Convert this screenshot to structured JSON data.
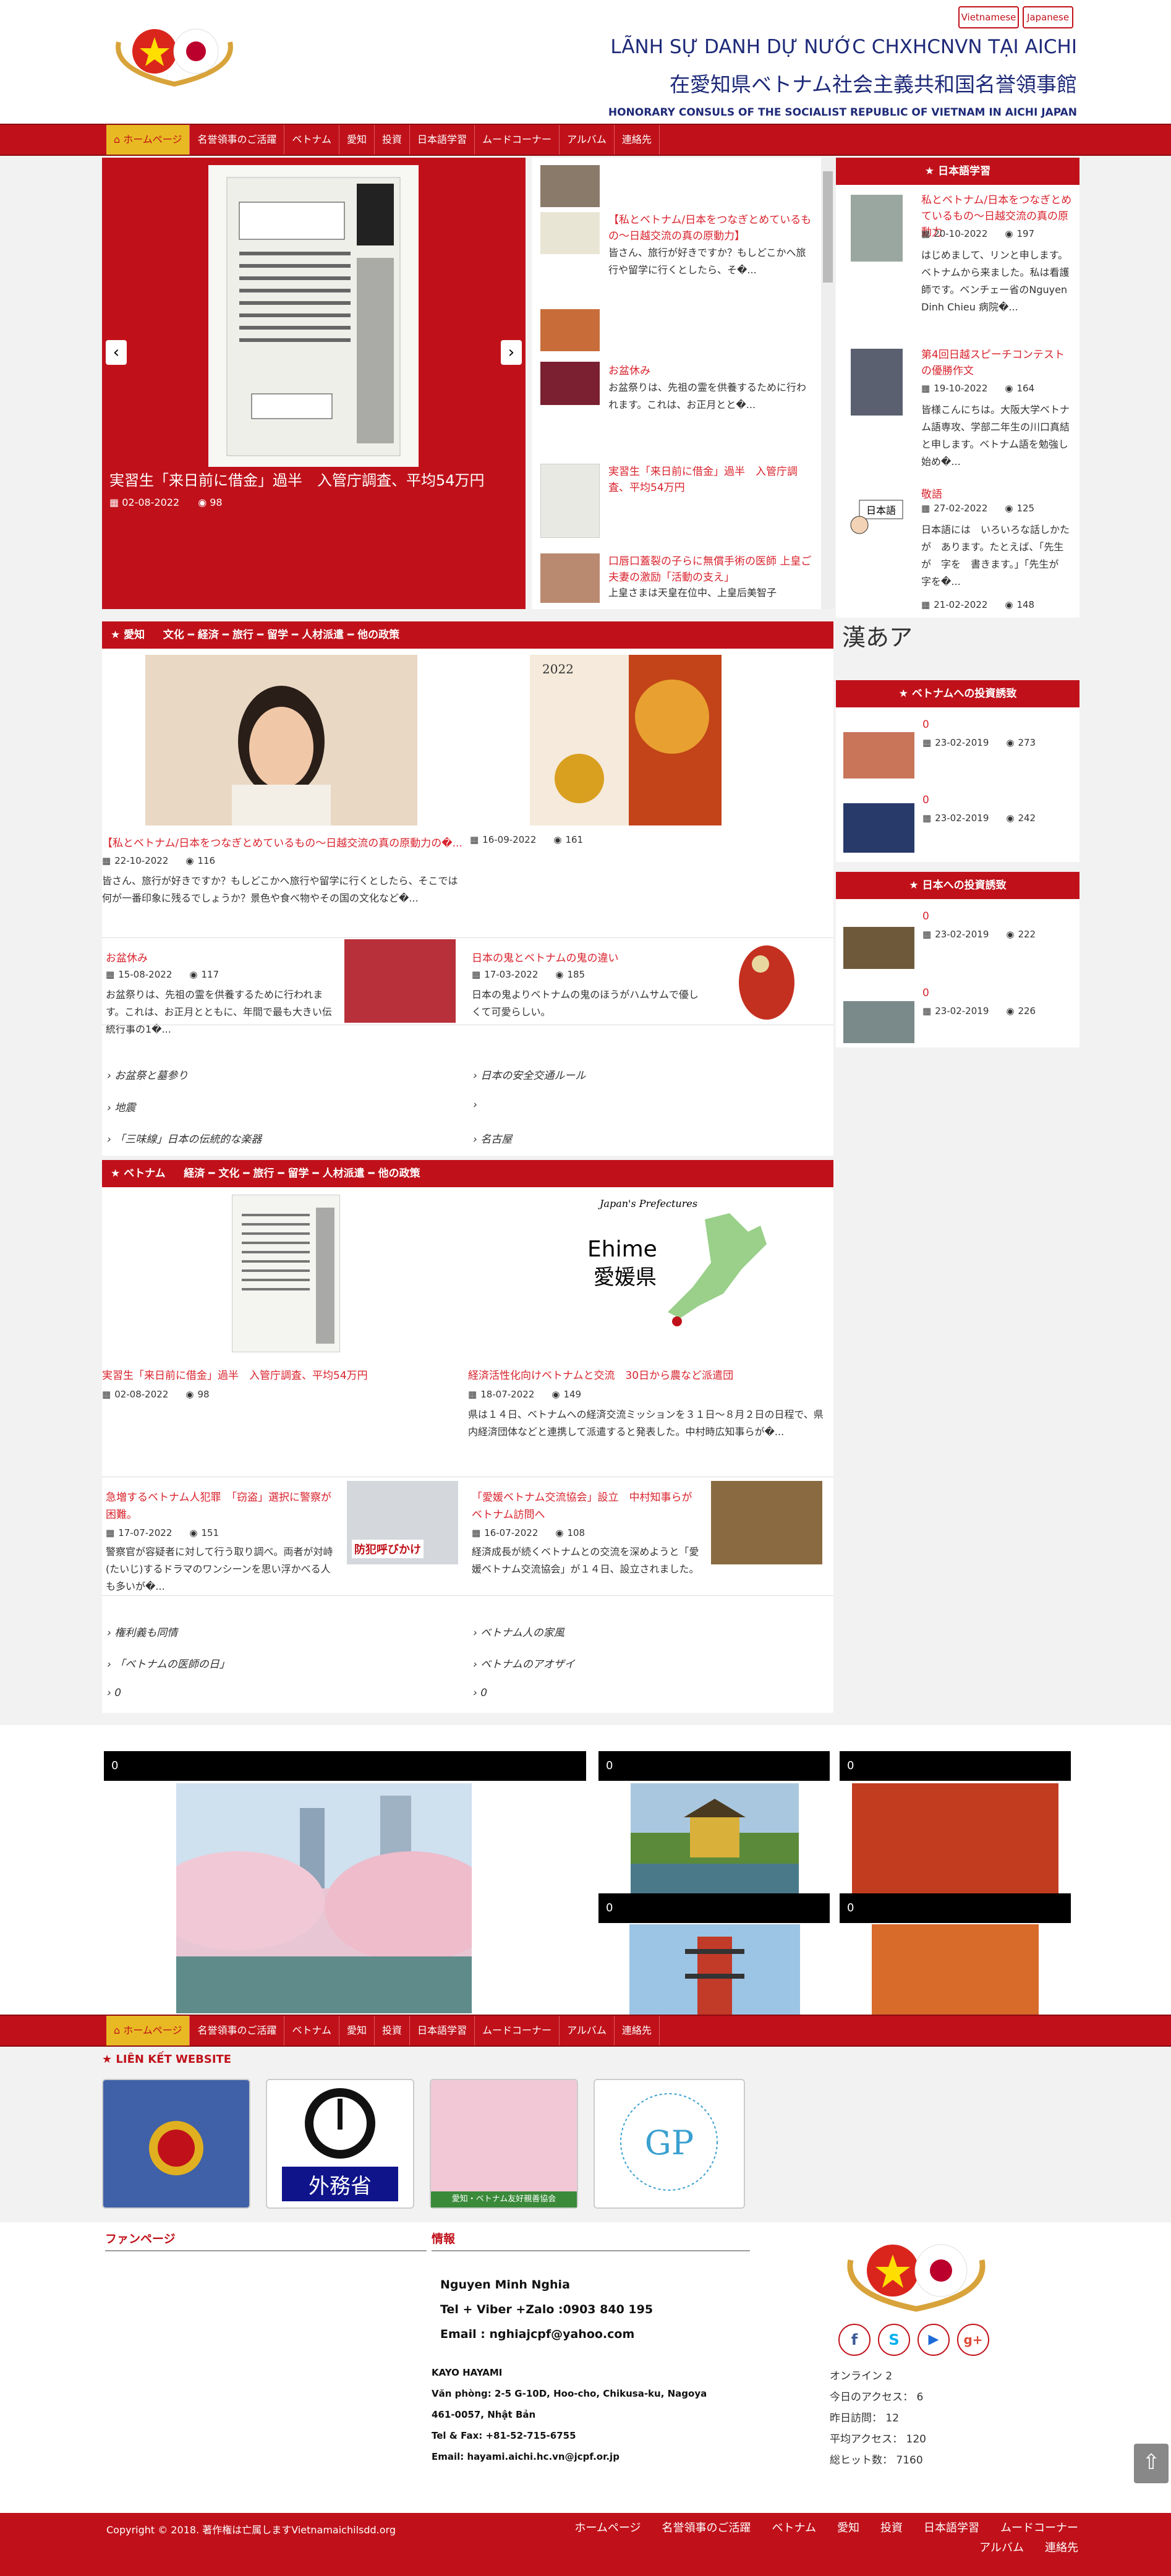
{
  "lang": {
    "vi": "Vietnamese",
    "ja": "Japanese"
  },
  "header": {
    "title_vi": "LÃNH SỰ DANH DỰ NƯỚC CHXHCNVN TẠI AICHI",
    "title_ja": "在愛知県ベトナム社会主義共和国名誉領事館",
    "title_en": "HONORARY CONSULS OF THE SOCIALIST REPUBLIC OF VIETNAM IN AICHI JAPAN"
  },
  "nav": [
    "ホームページ",
    "名誉領事のご活躍",
    "ベトナム",
    "愛知",
    "投資",
    "日本語学習",
    "ムードコーナー",
    "アルバム",
    "連絡先"
  ],
  "slider": {
    "caption": "実習生「来日前に借金」過半　入管庁調査、平均54万円",
    "date": "02-08-2022",
    "views": "98"
  },
  "news_list": [
    {
      "title": "",
      "text": ""
    },
    {
      "title": "【私とベトナム/日本をつなぎとめているもの～日越交流の真の原動力】",
      "text": "皆さん、旅行が好きですか？もしどこかへ旅行や留学に行くとしたら、そ�..."
    },
    {
      "title": "",
      "text": ""
    },
    {
      "title": "お盆休み",
      "text": "お盆祭りは、先祖の霊を供養するために行われます。これは、お正月とと�..."
    },
    {
      "title": "実習生「来日前に借金」過半　入管庁調査、平均54万円",
      "text": ""
    },
    {
      "title": "口唇口蓋裂の子らに無償手術の医師 上皇ご夫妻の激励「活動の支え」",
      "text": "上皇さまは天皇在位中、上皇后美智子"
    }
  ],
  "japanese_study": {
    "heading": "日本語学習",
    "items": [
      {
        "title": "私とベトナム/日本をつなぎとめているもの～日越交流の真の原動力",
        "date": "20-10-2022",
        "views": "197",
        "text": "はじめまして、リンと申します。ベトナムから来ました。私は看護師です。ベンチェー省のNguyen Dinh Chieu 病院�..."
      },
      {
        "title": "第4回日越スピーチコンテストの優勝作文",
        "date": "19-10-2022",
        "views": "164",
        "text": "皆様こんにちは。大阪大学ベトナム語専攻、学部二年生の川口真結と申します。ベトナム語を勉強し始め�..."
      },
      {
        "title": "敬語",
        "date": "27-02-2022",
        "views": "125",
        "text": "日本語には　いろいろな話しかたが　あります。たとえば、「先生が　字を　書きます。」「先生が　字を�..."
      },
      {
        "title": "",
        "date": "21-02-2022",
        "views": "148",
        "text": ""
      }
    ]
  },
  "kanji": "漢あア",
  "invest_vn": {
    "heading": "ベトナムへの投資誘致",
    "items": [
      {
        "title": "0",
        "date": "23-02-2019",
        "views": "273"
      },
      {
        "title": "0",
        "date": "23-02-2019",
        "views": "242"
      }
    ]
  },
  "invest_jp": {
    "heading": "日本への投資誘致",
    "items": [
      {
        "title": "0",
        "date": "23-02-2019",
        "views": "222"
      },
      {
        "title": "0",
        "date": "23-02-2019",
        "views": "226"
      }
    ]
  },
  "aichi_bar": {
    "main": "愛知",
    "subs": [
      "文化",
      "経済",
      "旅行",
      "留学",
      "人材派遣",
      "他の政策"
    ]
  },
  "aichi": {
    "big": [
      {
        "title": "【私とベトナム/日本をつなぎとめているもの～日越交流の真の原動力の�...",
        "date": "22-10-2022",
        "views": "116",
        "text": "皆さん、旅行が好きですか？もしどこかへ旅行や留学に行くとしたら、そこでは何が一番印象に残るでしょうか？景色や食べ物やその国の文化など�..."
      },
      {
        "title": "",
        "date": "16-09-2022",
        "views": "161",
        "text": ""
      }
    ],
    "small": [
      {
        "title": "お盆休み",
        "date": "15-08-2022",
        "views": "117",
        "text": "お盆祭りは、先祖の霊を供養するために行われます。これは、お正月とともに、年間で最も大きい伝統行事の1�..."
      },
      {
        "title": "日本の鬼とベトナムの鬼の違い",
        "date": "17-03-2022",
        "views": "185",
        "text": "日本の鬼よりベトナムの鬼のほうがハムサムで優しくて可愛らしい。"
      }
    ],
    "links": [
      "お盆祭と墓参り",
      "日本の安全交通ルール",
      "地震",
      "",
      "「三味線」日本の伝統的な楽器",
      "名古屋"
    ]
  },
  "vietnam_bar": {
    "main": "ベトナム",
    "subs": [
      "経済",
      "文化",
      "旅行",
      "留学",
      "人材派遣",
      "他の政策"
    ]
  },
  "vietnam": {
    "big": [
      {
        "title": "実習生「来日前に借金」過半　入管庁調査、平均54万円",
        "date": "02-08-2022",
        "views": "98",
        "text": ""
      },
      {
        "title": "経済活性化向けベトナムと交流　30日から農など派遣団",
        "date": "18-07-2022",
        "views": "149",
        "text": "県は１４日、ベトナムへの経済交流ミッションを３１日～８月２日の日程で、県内経済団体などと連携して派遣すると発表した。中村時広知事らが�..."
      }
    ],
    "small": [
      {
        "title": "急増するベトナム人犯罪　「窃盗」選択に警察が困難。",
        "date": "17-07-2022",
        "views": "151",
        "text": "警察官が容疑者に対して行う取り調べ。両者が対峙(たいじ)するドラマのワンシーンを思い浮かべる人も多いが�..."
      },
      {
        "title": "「愛媛ベトナム交流協会」設立　中村知事らがベトナム訪問へ",
        "date": "16-07-2022",
        "views": "108",
        "text": "経済成長が続くベトナムとの交流を深めようと「愛媛ベトナム交流協会」が１４日、設立されました。"
      }
    ],
    "links": [
      "権利義も同情",
      "ベトナム人の家風",
      "「ベトナムの医師の日」",
      "ベトナムのアオザイ",
      "0",
      "0"
    ],
    "ehime": "愛媛県",
    "ehime_en": "Ehime",
    "prefectures": "Japan's Prefectures",
    "poster": "防犯呼びかけ"
  },
  "gallery": [
    "0",
    "0",
    "0",
    "0",
    "0"
  ],
  "links_title": "LIÊN KẾT WEBSITE",
  "link_logos": {
    "mofa": "外務省",
    "aichi": "愛知・ベトナム友好親善協会",
    "gp": "GP"
  },
  "footer": {
    "fanpage": "ファンページ",
    "info": "情報",
    "name": "Nguyen Minh Nghia",
    "tel": "Tel + Viber +Zalo :0903 840 195",
    "email": "Email : nghiajcpf@yahoo.com",
    "company": "KAYO HAYAMI",
    "office": "Văn phòng: 2-5 G-10D, Hoo-cho, Chikusa-ku, Nagoya",
    "postal": "461-0057, Nhật Bản",
    "telfax": "Tel & Fax: +81-52-715-6755",
    "email2": "Email: hayami.aichi.hc.vn@jcpf.or.jp",
    "stats": [
      "オンライン 2",
      "今日のアクセス： 6",
      "昨日訪問： 12",
      "平均アクセス： 120",
      "総ヒット数： 7160"
    ]
  },
  "copyright": "Copyright © 2018. 著作権は亡属しますVietnamaichilsdd.org",
  "bottom_nav": [
    "ホームページ",
    "名誉領事のご活躍",
    "ベトナム",
    "愛知",
    "投資",
    "日本語学習",
    "ムードコーナー",
    "アルバム",
    "連絡先"
  ],
  "calendar_icon": "calendar-icon",
  "eye_icon": "eye-icon",
  "colors": {
    "brand": "#c0111a",
    "navy": "#1e2a78",
    "gold": "#e8b923"
  }
}
